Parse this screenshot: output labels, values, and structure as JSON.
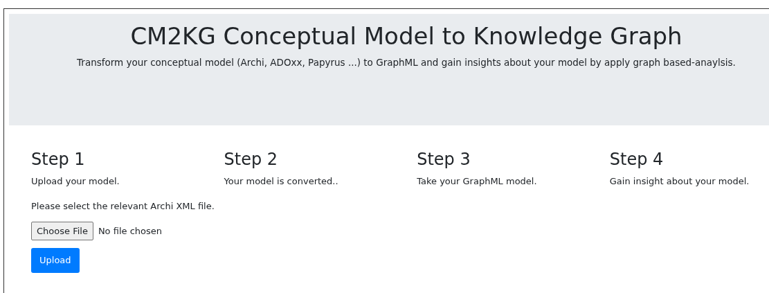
{
  "header": {
    "title": "CM2KG Conceptual Model to Knowledge Graph",
    "subtitle": "Transform your conceptual model (Archi, ADOxx, Papyrus ...) to GraphML and gain insights about your model by apply graph based-anaylsis."
  },
  "steps": [
    {
      "title": "Step 1",
      "text": "Upload your model."
    },
    {
      "title": "Step 2",
      "text": "Your model is converted.."
    },
    {
      "title": "Step 3",
      "text": "Take your GraphML model."
    },
    {
      "title": "Step 4",
      "text": "Gain insight about your model."
    }
  ],
  "upload": {
    "prompt": "Please select the relevant Archi XML file.",
    "choose_button": "Choose File",
    "file_status": "No file chosen",
    "submit_button": "Upload"
  }
}
